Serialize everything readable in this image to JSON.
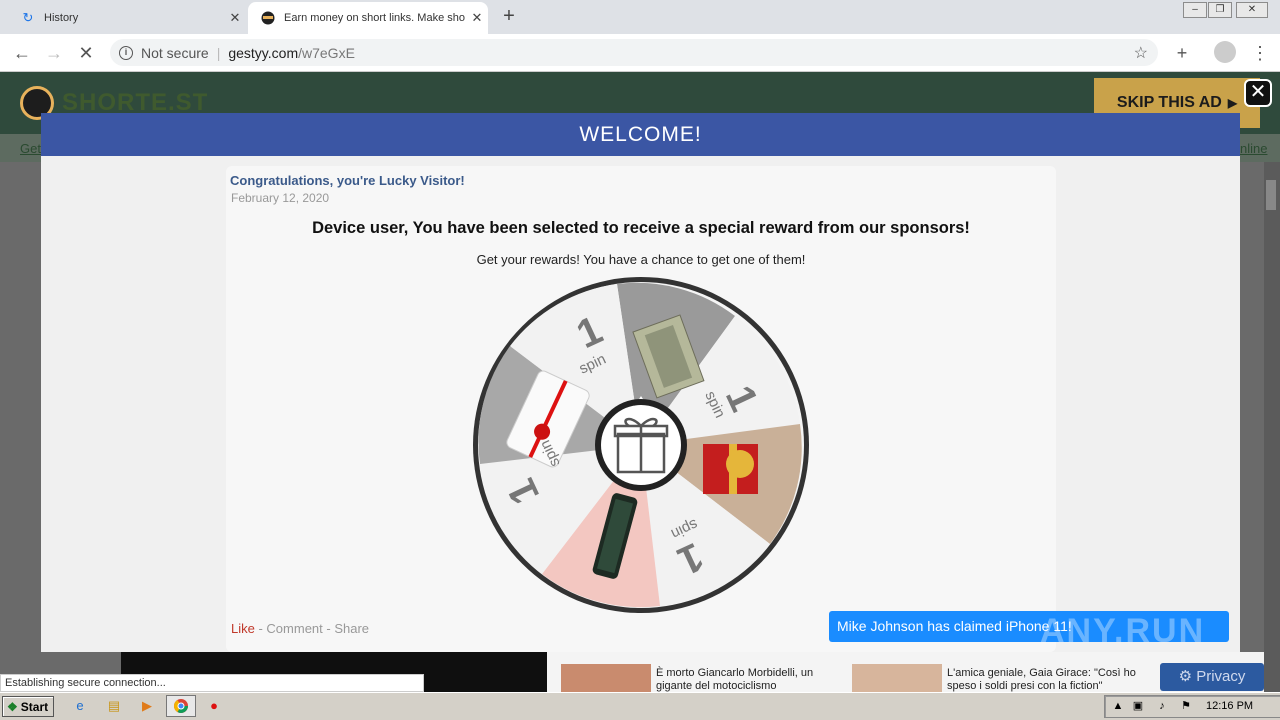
{
  "browser": {
    "tabs": [
      {
        "title": "History",
        "icon": "history-icon"
      },
      {
        "title": "Earn money on short links. Make sho",
        "icon": "shortest-favicon"
      }
    ],
    "url_security": "Not secure",
    "url_host": "gestyy.com",
    "url_path": "/w7eGxE",
    "status_text": "Establishing secure connection..."
  },
  "site": {
    "logo_text": "SHORTE.ST",
    "skip_ad": "SKIP THIS AD",
    "nav_left": "Get",
    "nav_right": "nline"
  },
  "modal": {
    "header": "WELCOME!",
    "card_title": "Congratulations, you're Lucky Visitor!",
    "card_date": "February 12, 2020",
    "headline": "Device user, You have been selected to receive a special reward from our sponsors!",
    "subline": "Get your rewards! You have a chance to get one of them!",
    "wheel": {
      "segment_labels": [
        "1 spin",
        "1 spin",
        "1 spin",
        "1 spin"
      ],
      "prize_icons": [
        "money-icon",
        "gift-box-icon",
        "phone-icon",
        "gift-card-icon"
      ],
      "center_icon": "gift-icon"
    },
    "actions": {
      "like": "Like",
      "comment": "Comment",
      "share": "Share",
      "separator": " - "
    }
  },
  "toast": "Mike Johnson has claimed iPhone 11!",
  "news": [
    {
      "text": "È morto Giancarlo Morbidelli, un gigante del motociclismo internazionale"
    },
    {
      "text": "L'amica geniale, Gaia Girace: \"Così ho speso i soldi presi con la fiction\""
    }
  ],
  "privacy_label": "Privacy",
  "watermark": "ANY.RUN",
  "taskbar": {
    "start": "Start",
    "clock": "12:16 PM"
  },
  "colors": {
    "modal_header": "#3b56a4",
    "toast": "#1a8cff",
    "skip_ad": "#c9a24a"
  }
}
